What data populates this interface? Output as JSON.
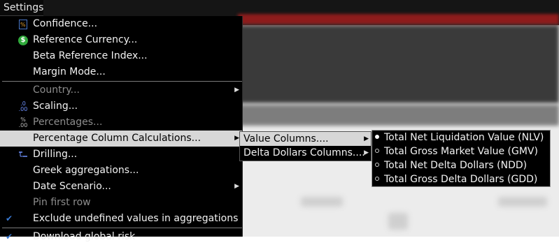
{
  "menu_title": "Settings",
  "main_menu": {
    "confidence": "Confidence...",
    "reference_currency": "Reference Currency...",
    "beta_reference_index": "Beta Reference Index...",
    "margin_mode": "Margin Mode...",
    "country": "Country...",
    "scaling": "Scaling...",
    "percentages": "Percentages...",
    "percentage_column_calculations": "Percentage Column Calculations...",
    "drilling": "Drilling...",
    "greek_aggregations": "Greek aggregations...",
    "date_scenario": "Date Scenario...",
    "pin_first_row": "Pin first row",
    "exclude_undefined": "Exclude undefined values in aggregations",
    "download_global_risk": "Download global risk"
  },
  "submenu_columns": {
    "value_columns": "Value Columns....",
    "delta_dollars_columns": "Delta Dollars Columns...."
  },
  "submenu_values": {
    "options": [
      {
        "label": "Total Net Liquidation Value (NLV)",
        "selected": true
      },
      {
        "label": "Total Gross Market Value (GMV)",
        "selected": false
      },
      {
        "label": "Total Net Delta Dollars (NDD)",
        "selected": false
      },
      {
        "label": "Total Gross Delta Dollars (GDD)",
        "selected": false
      }
    ]
  },
  "icons": {
    "percent_icon_text": "%",
    "percent_icon_sub": ".00",
    "scaling_icon_top": ".0",
    "scaling_icon_bottom": ".00",
    "currency_icon_text": "$"
  },
  "colors": {
    "menu_bg": "#000000",
    "highlight_bg": "#d7d7d7",
    "disabled_text": "#8d8d8d",
    "check_color": "#3a7bd5",
    "currency_icon": "#2fa83a"
  }
}
